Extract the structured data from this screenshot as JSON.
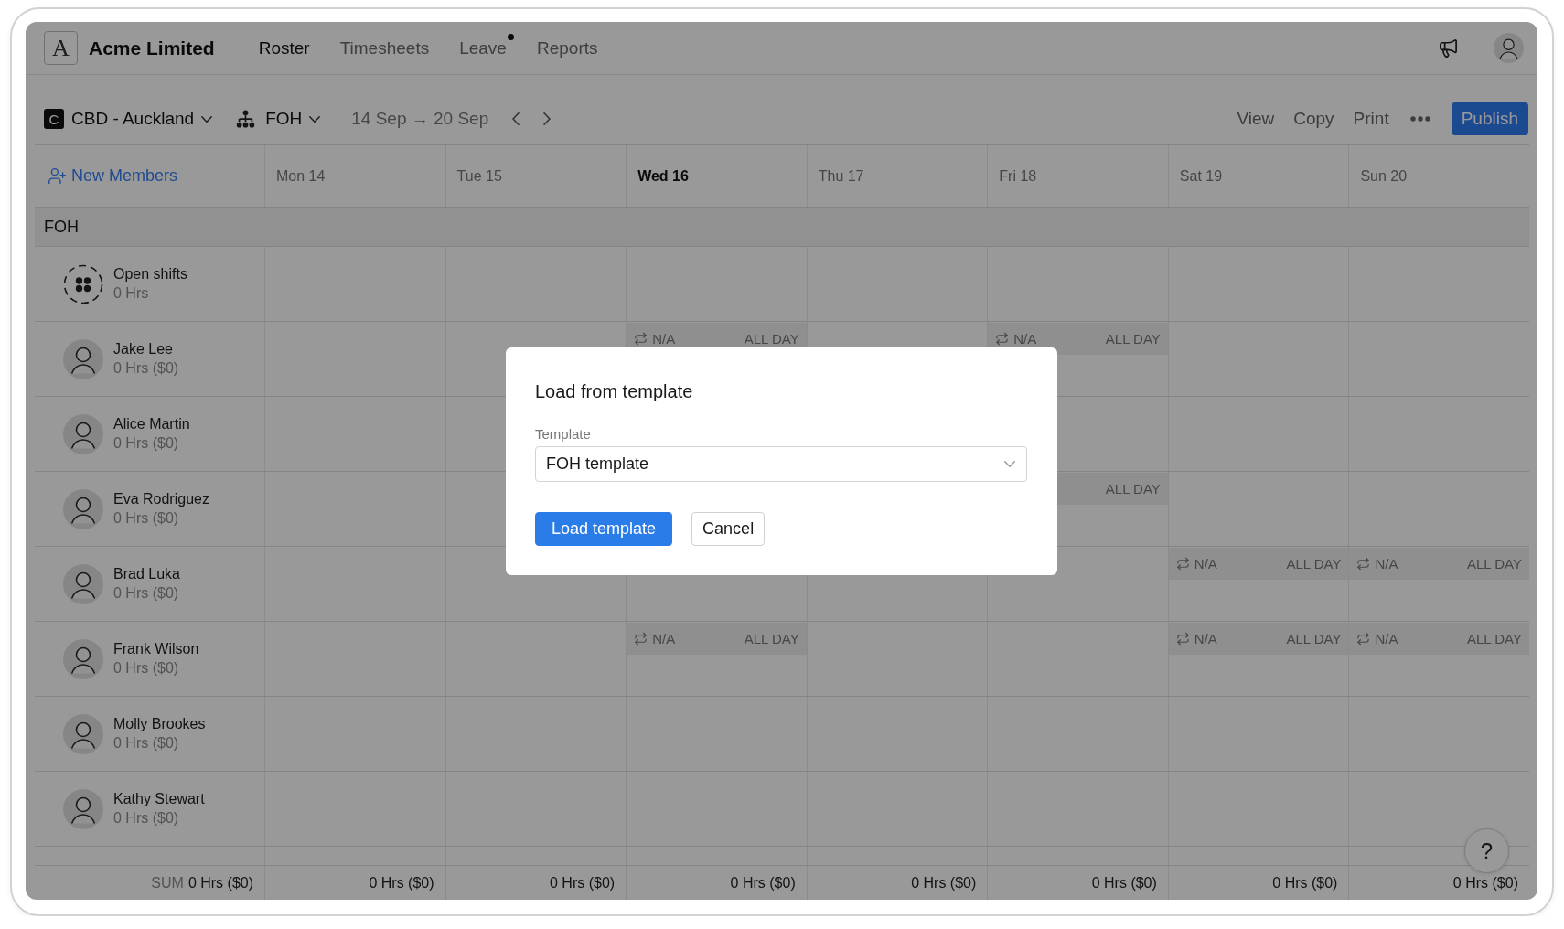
{
  "app": {
    "logo": "A",
    "company": "Acme Limited"
  },
  "nav": [
    {
      "label": "Roster",
      "selected": true,
      "dot": false
    },
    {
      "label": "Timesheets",
      "selected": false,
      "dot": false
    },
    {
      "label": "Leave",
      "selected": false,
      "dot": true
    },
    {
      "label": "Reports",
      "selected": false,
      "dot": false
    }
  ],
  "toolbar": {
    "location_badge": "C",
    "location": "CBD - Auckland",
    "team": "FOH",
    "date_range": "14 Sep → 20 Sep",
    "actions": [
      "View",
      "Copy",
      "Print"
    ],
    "publish": "Publish"
  },
  "roster": {
    "new_members": "New Members",
    "days": [
      {
        "label": "Mon 14",
        "selected": false
      },
      {
        "label": "Tue 15",
        "selected": false
      },
      {
        "label": "Wed 16",
        "selected": true
      },
      {
        "label": "Thu 17",
        "selected": false
      },
      {
        "label": "Fri 18",
        "selected": false
      },
      {
        "label": "Sat 19",
        "selected": false
      },
      {
        "label": "Sun 20",
        "selected": false
      }
    ],
    "group": "FOH",
    "rows": [
      {
        "kind": "open_shifts",
        "name": "Open shifts",
        "hours": "0 Hrs",
        "cells": [
          {
            "kind": "empty"
          },
          {
            "kind": "empty"
          },
          {
            "kind": "empty"
          },
          {
            "kind": "empty"
          },
          {
            "kind": "empty"
          },
          {
            "kind": "empty"
          },
          {
            "kind": "empty"
          }
        ]
      },
      {
        "kind": "member",
        "name": "Jake Lee",
        "hours": "0 Hrs ($0)",
        "cells": [
          {
            "kind": "empty"
          },
          {
            "kind": "empty"
          },
          {
            "kind": "unavailable",
            "label": "N/A",
            "time": "ALL DAY"
          },
          {
            "kind": "empty"
          },
          {
            "kind": "unavailable",
            "label": "N/A",
            "time": "ALL DAY"
          },
          {
            "kind": "empty"
          },
          {
            "kind": "empty"
          }
        ]
      },
      {
        "kind": "member",
        "name": "Alice Martin",
        "hours": "0 Hrs ($0)",
        "cells": [
          {
            "kind": "empty"
          },
          {
            "kind": "empty"
          },
          {
            "kind": "empty"
          },
          {
            "kind": "empty"
          },
          {
            "kind": "empty"
          },
          {
            "kind": "empty"
          },
          {
            "kind": "empty"
          }
        ]
      },
      {
        "kind": "member",
        "name": "Eva Rodriguez",
        "hours": "0 Hrs ($0)",
        "cells": [
          {
            "kind": "empty"
          },
          {
            "kind": "empty"
          },
          {
            "kind": "empty"
          },
          {
            "kind": "empty"
          },
          {
            "kind": "unavailable",
            "time": "ALL DAY"
          },
          {
            "kind": "empty"
          },
          {
            "kind": "empty"
          }
        ]
      },
      {
        "kind": "member",
        "name": "Brad Luka",
        "hours": "0 Hrs ($0)",
        "cells": [
          {
            "kind": "empty"
          },
          {
            "kind": "empty"
          },
          {
            "kind": "empty"
          },
          {
            "kind": "empty"
          },
          {
            "kind": "empty"
          },
          {
            "kind": "unavailable",
            "label": "N/A",
            "time": "ALL DAY"
          },
          {
            "kind": "unavailable",
            "label": "N/A",
            "time": "ALL DAY"
          }
        ]
      },
      {
        "kind": "member",
        "name": "Frank Wilson",
        "hours": "0 Hrs ($0)",
        "cells": [
          {
            "kind": "empty"
          },
          {
            "kind": "empty"
          },
          {
            "kind": "unavailable",
            "label": "N/A",
            "time": "ALL DAY"
          },
          {
            "kind": "empty"
          },
          {
            "kind": "empty"
          },
          {
            "kind": "unavailable",
            "label": "N/A",
            "time": "ALL DAY"
          },
          {
            "kind": "unavailable",
            "label": "N/A",
            "time": "ALL DAY"
          }
        ]
      },
      {
        "kind": "member",
        "name": "Molly Brookes",
        "hours": "0 Hrs ($0)",
        "cells": [
          {
            "kind": "empty"
          },
          {
            "kind": "empty"
          },
          {
            "kind": "empty"
          },
          {
            "kind": "empty"
          },
          {
            "kind": "empty"
          },
          {
            "kind": "empty"
          },
          {
            "kind": "empty"
          }
        ]
      },
      {
        "kind": "member",
        "name": "Kathy Stewart",
        "hours": "0 Hrs ($0)",
        "cells": [
          {
            "kind": "empty"
          },
          {
            "kind": "empty"
          },
          {
            "kind": "empty"
          },
          {
            "kind": "empty"
          },
          {
            "kind": "empty"
          },
          {
            "kind": "empty"
          },
          {
            "kind": "empty"
          }
        ]
      }
    ],
    "footer": {
      "sum_label": "SUM",
      "total": "0 Hrs ($0)",
      "day_totals": [
        "0 Hrs ($0)",
        "0 Hrs ($0)",
        "0 Hrs ($0)",
        "0 Hrs ($0)",
        "0 Hrs ($0)",
        "0 Hrs ($0)",
        "0 Hrs ($0)"
      ]
    }
  },
  "help": "?",
  "dialog": {
    "title": "Load from template",
    "field_label": "Template",
    "value": "FOH template",
    "buttons": [
      {
        "label": "Load template",
        "kind": "primary"
      },
      {
        "label": "Cancel",
        "kind": "secondary"
      }
    ]
  }
}
